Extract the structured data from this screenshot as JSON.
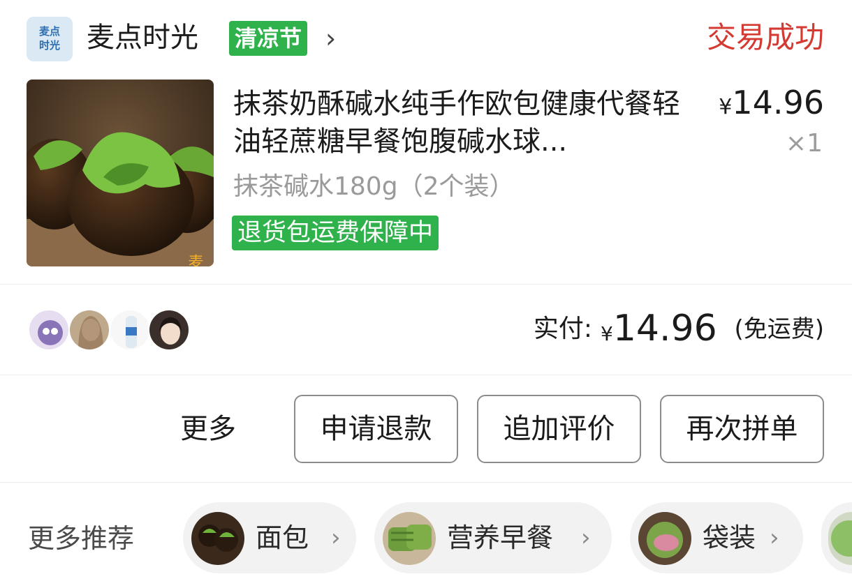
{
  "shop": {
    "logo_text": "麦点\n时光",
    "name": "麦点时光",
    "badge": "清凉节",
    "chevron": "›"
  },
  "order": {
    "status": "交易成功",
    "status_color": "#d33a31"
  },
  "product": {
    "title": "抹茶奶酥碱水纯手作欧包健康代餐轻油轻蔗糖早餐饱腹碱水球...",
    "currency": "¥",
    "price": "14.96",
    "quantity": "×1",
    "spec": "抹茶碱水180g（2个装）",
    "guarantee": "退货包运费保障中",
    "image_icon": "matcha-bread-photo"
  },
  "payment": {
    "label": "实付:",
    "currency": "¥",
    "amount": "14.96",
    "note": "(免运费)"
  },
  "actions": {
    "more": "更多",
    "buttons": [
      "申请退款",
      "追加评价",
      "再次拼单"
    ]
  },
  "recommend": {
    "label": "更多推荐",
    "chips": [
      "面包",
      "营养早餐",
      "袋装"
    ],
    "chevron": "›"
  },
  "colors": {
    "brand_green": "#2fb24c",
    "status_red": "#d33a31",
    "chip_bg": "#f2f2f2"
  }
}
